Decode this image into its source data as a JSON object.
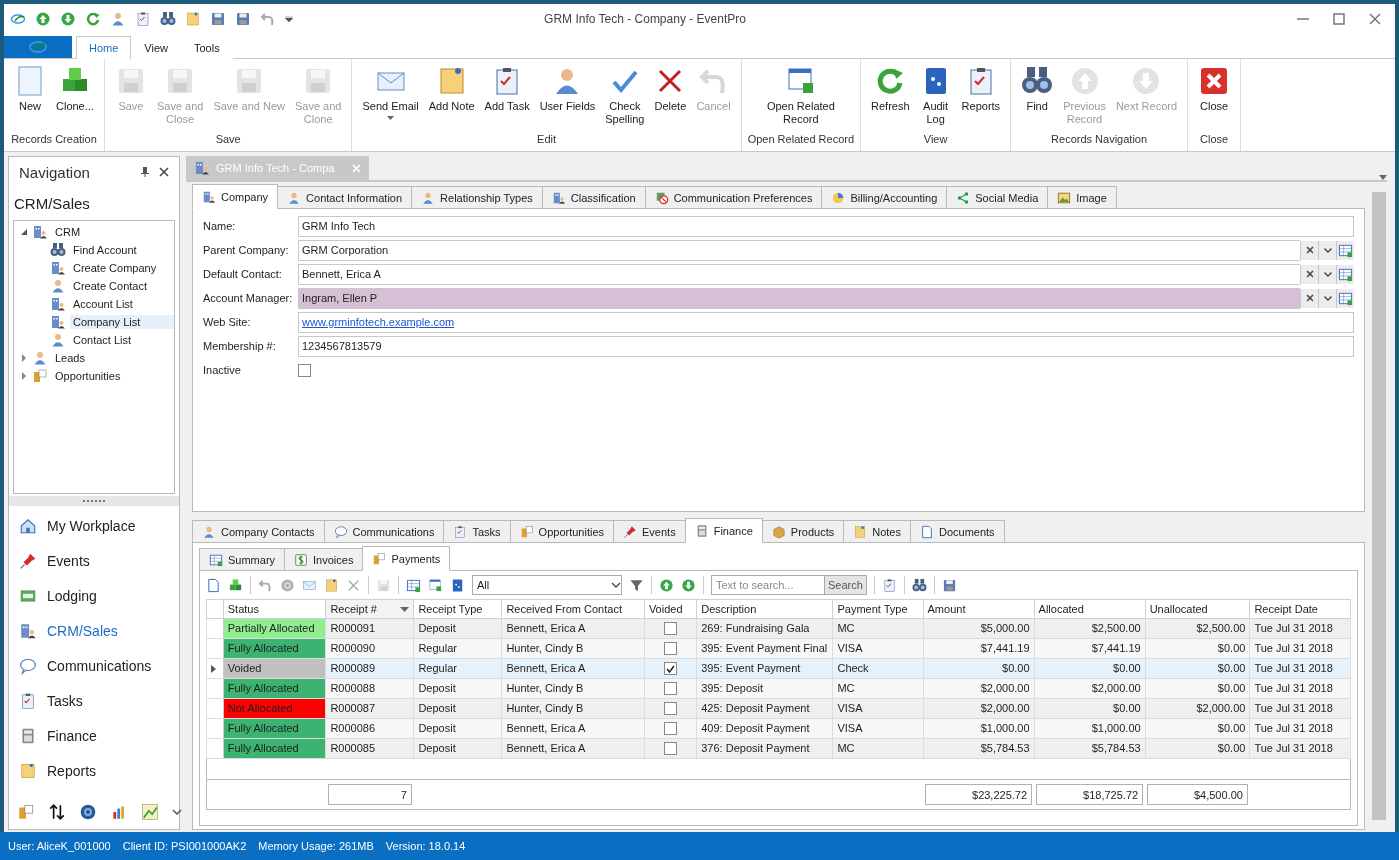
{
  "window": {
    "title": "GRM Info Tech - Company - EventPro"
  },
  "ribbon_tabs": [
    {
      "label": "Home",
      "selected": true
    },
    {
      "label": "View",
      "selected": false
    },
    {
      "label": "Tools",
      "selected": false
    }
  ],
  "ribbon_groups": [
    {
      "label": "Records Creation",
      "buttons": [
        {
          "label": "New",
          "disabled": false
        },
        {
          "label": "Clone...",
          "disabled": false
        }
      ]
    },
    {
      "label": "Save",
      "buttons": [
        {
          "label": "Save",
          "disabled": true
        },
        {
          "label": "Save and\nClose",
          "disabled": true
        },
        {
          "label": "Save and New",
          "disabled": true
        },
        {
          "label": "Save and\nClone",
          "disabled": true
        }
      ]
    },
    {
      "label": "Edit",
      "buttons": [
        {
          "label": "Send Email",
          "disabled": false,
          "dropdown": true
        },
        {
          "label": "Add Note",
          "disabled": false
        },
        {
          "label": "Add Task",
          "disabled": false
        },
        {
          "label": "User Fields",
          "disabled": false
        },
        {
          "label": "Check\nSpelling",
          "disabled": false
        },
        {
          "label": "Delete",
          "disabled": false
        },
        {
          "label": "Cancel",
          "disabled": true
        }
      ]
    },
    {
      "label": "Open Related Record",
      "buttons": [
        {
          "label": "Open Related\nRecord",
          "disabled": false
        }
      ]
    },
    {
      "label": "View",
      "buttons": [
        {
          "label": "Refresh",
          "disabled": false
        },
        {
          "label": "Audit\nLog",
          "disabled": false
        },
        {
          "label": "Reports",
          "disabled": false
        }
      ]
    },
    {
      "label": "Records Navigation",
      "buttons": [
        {
          "label": "Find",
          "disabled": false
        },
        {
          "label": "Previous\nRecord",
          "disabled": true
        },
        {
          "label": "Next Record",
          "disabled": true
        }
      ]
    },
    {
      "label": "Close",
      "buttons": [
        {
          "label": "Close",
          "disabled": false
        }
      ]
    }
  ],
  "navigation": {
    "title": "Navigation",
    "section": "CRM/Sales",
    "tree": [
      {
        "label": "CRM",
        "expanded": true,
        "selected": false,
        "children": [
          {
            "label": "Find Account",
            "selected": false
          },
          {
            "label": "Create Company",
            "selected": false
          },
          {
            "label": "Create Contact",
            "selected": false
          },
          {
            "label": "Account List",
            "selected": false
          },
          {
            "label": "Company List",
            "selected": true
          },
          {
            "label": "Contact List",
            "selected": false
          }
        ]
      },
      {
        "label": "Leads",
        "expanded": false,
        "selected": false
      },
      {
        "label": "Opportunities",
        "expanded": false,
        "selected": false
      }
    ],
    "modules": [
      {
        "label": "My Workplace",
        "selected": false
      },
      {
        "label": "Events",
        "selected": false
      },
      {
        "label": "Lodging",
        "selected": false
      },
      {
        "label": "CRM/Sales",
        "selected": true
      },
      {
        "label": "Communications",
        "selected": false
      },
      {
        "label": "Tasks",
        "selected": false
      },
      {
        "label": "Finance",
        "selected": false
      },
      {
        "label": "Reports",
        "selected": false
      }
    ]
  },
  "document_tab": {
    "title": "GRM Info Tech - Compa"
  },
  "detail_tabs": [
    {
      "label": "Company",
      "selected": true
    },
    {
      "label": "Contact Information",
      "selected": false
    },
    {
      "label": "Relationship Types",
      "selected": false
    },
    {
      "label": "Classification",
      "selected": false
    },
    {
      "label": "Communication Preferences",
      "selected": false
    },
    {
      "label": "Billing/Accounting",
      "selected": false
    },
    {
      "label": "Social Media",
      "selected": false
    },
    {
      "label": "Image",
      "selected": false
    }
  ],
  "fields": [
    {
      "kind": "text",
      "label": "Name:",
      "value": "GRM Info Tech"
    },
    {
      "kind": "lookup",
      "label": "Parent Company:",
      "value": "GRM Corporation",
      "highlighted": false
    },
    {
      "kind": "lookup",
      "label": "Default Contact:",
      "value": "Bennett, Erica A",
      "highlighted": false
    },
    {
      "kind": "lookup",
      "label": "Account Manager:",
      "value": "Ingram, Ellen P",
      "highlighted": true
    },
    {
      "kind": "link",
      "label": "Web Site:",
      "value": "www.grminfotech.example.com"
    },
    {
      "kind": "text",
      "label": "Membership #:",
      "value": "1234567813579"
    },
    {
      "kind": "checkbox",
      "label": "Inactive",
      "checked": false
    }
  ],
  "bottom_tabs": [
    {
      "label": "Company Contacts",
      "selected": false
    },
    {
      "label": "Communications",
      "selected": false
    },
    {
      "label": "Tasks",
      "selected": false
    },
    {
      "label": "Opportunities",
      "selected": false
    },
    {
      "label": "Events",
      "selected": false
    },
    {
      "label": "Finance",
      "selected": true
    },
    {
      "label": "Products",
      "selected": false
    },
    {
      "label": "Notes",
      "selected": false
    },
    {
      "label": "Documents",
      "selected": false
    }
  ],
  "finance_tabs": [
    {
      "label": "Summary",
      "selected": false
    },
    {
      "label": "Invoices",
      "selected": false
    },
    {
      "label": "Payments",
      "selected": true
    }
  ],
  "toolbar": {
    "filter": "All",
    "search_placeholder": "Text to search...",
    "search_button": "Search"
  },
  "table": {
    "columns": [
      {
        "label": "Status",
        "sorted": false
      },
      {
        "label": "Receipt #",
        "sorted": true
      },
      {
        "label": "Receipt Type",
        "sorted": false
      },
      {
        "label": "Received From Contact",
        "sorted": false
      },
      {
        "label": "Voided",
        "sorted": false
      },
      {
        "label": "Description",
        "sorted": false
      },
      {
        "label": "Payment Type",
        "sorted": false
      },
      {
        "label": "Amount",
        "sorted": false
      },
      {
        "label": "Allocated",
        "sorted": false
      },
      {
        "label": "Unallocated",
        "sorted": false
      },
      {
        "label": "Receipt Date",
        "sorted": false
      }
    ],
    "rows": [
      {
        "status": "Partially Allocated",
        "color": "#90ee90",
        "receipt": "R000091",
        "type": "Deposit",
        "contact": "Bennett, Erica A",
        "voided": false,
        "description": "269: Fundraising Gala",
        "payment": "MC",
        "amount": "$5,000.00",
        "allocated": "$2,500.00",
        "unallocated": "$2,500.00",
        "date": "Tue Jul 31 2018",
        "selected": false
      },
      {
        "status": "Fully Allocated",
        "color": "#3cb371",
        "receipt": "R000090",
        "type": "Regular",
        "contact": "Hunter, Cindy B",
        "voided": false,
        "description": "395: Event Payment Final",
        "payment": "VISA",
        "amount": "$7,441.19",
        "allocated": "$7,441.19",
        "unallocated": "$0.00",
        "date": "Tue Jul 31 2018",
        "selected": false
      },
      {
        "status": "Voided",
        "color": "#c0c0c0",
        "receipt": "R000089",
        "type": "Regular",
        "contact": "Bennett, Erica A",
        "voided": true,
        "description": "395: Event Payment",
        "payment": "Check",
        "amount": "$0.00",
        "allocated": "$0.00",
        "unallocated": "$0.00",
        "date": "Tue Jul 31 2018",
        "selected": true
      },
      {
        "status": "Fully Allocated",
        "color": "#3cb371",
        "receipt": "R000088",
        "type": "Deposit",
        "contact": "Hunter, Cindy B",
        "voided": false,
        "description": "395: Deposit",
        "payment": "MC",
        "amount": "$2,000.00",
        "allocated": "$2,000.00",
        "unallocated": "$0.00",
        "date": "Tue Jul 31 2018",
        "selected": false
      },
      {
        "status": "Not Allocated",
        "color": "#ff0000",
        "receipt": "R000087",
        "type": "Deposit",
        "contact": "Hunter, Cindy B",
        "voided": false,
        "description": "425: Deposit Payment",
        "payment": "VISA",
        "amount": "$2,000.00",
        "allocated": "$0.00",
        "unallocated": "$2,000.00",
        "date": "Tue Jul 31 2018",
        "selected": false
      },
      {
        "status": "Fully Allocated",
        "color": "#3cb371",
        "receipt": "R000086",
        "type": "Deposit",
        "contact": "Bennett, Erica A",
        "voided": false,
        "description": "409: Deposit Payment",
        "payment": "VISA",
        "amount": "$1,000.00",
        "allocated": "$1,000.00",
        "unallocated": "$0.00",
        "date": "Tue Jul 31 2018",
        "selected": false
      },
      {
        "status": "Fully Allocated",
        "color": "#3cb371",
        "receipt": "R000085",
        "type": "Deposit",
        "contact": "Bennett, Erica A",
        "voided": false,
        "description": "376: Deposit Payment",
        "payment": "MC",
        "amount": "$5,784.53",
        "allocated": "$5,784.53",
        "unallocated": "$0.00",
        "date": "Tue Jul 31 2018",
        "selected": false
      }
    ],
    "totals": {
      "receipt": "7",
      "amount": "$23,225.72",
      "allocated": "$18,725.72",
      "unallocated": "$4,500.00"
    }
  },
  "status_bar": [
    "User: AliceK_001000",
    "Client ID: PSI001000AK2",
    "Memory Usage: 261MB",
    "Version: 18.0.14"
  ]
}
